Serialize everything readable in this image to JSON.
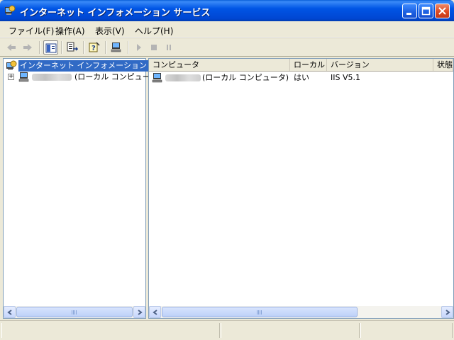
{
  "window": {
    "title": "インターネット インフォメーション サービス"
  },
  "menu": {
    "file": "ファイル(F)",
    "action": "操作(A)",
    "view": "表示(V)",
    "help": "ヘルプ(H)"
  },
  "toolbar": {
    "icons": [
      "back-arrow-icon",
      "forward-arrow-icon",
      "show-hide-tree-icon",
      "export-list-icon",
      "help-icon",
      "computer-icon",
      "start-icon",
      "stop-icon",
      "pause-icon"
    ]
  },
  "tree": {
    "root_label": "インターネット インフォメーション サービス",
    "child_suffix": "(ローカル コンピュータ)",
    "expand_glyph": "+"
  },
  "list": {
    "columns": [
      "コンピュータ",
      "ローカル",
      "バージョン",
      "状態"
    ],
    "rows": [
      {
        "computer_suffix": "(ローカル コンピュータ)",
        "local": "はい",
        "version": "IIS V5.1",
        "status": ""
      }
    ]
  },
  "colors": {
    "title_blue": "#0055e5",
    "selection": "#316ac5",
    "window_bg": "#ece9d8"
  }
}
